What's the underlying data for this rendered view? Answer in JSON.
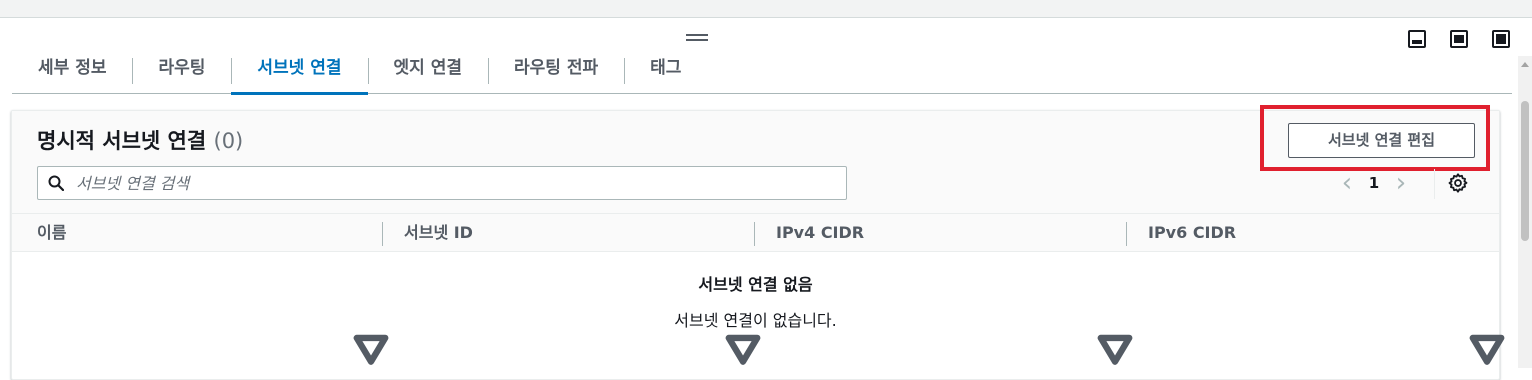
{
  "tabs": [
    {
      "label": "세부 정보"
    },
    {
      "label": "라우팅"
    },
    {
      "label": "서브넷 연결"
    },
    {
      "label": "엣지 연결"
    },
    {
      "label": "라우팅 전파"
    },
    {
      "label": "태그"
    }
  ],
  "active_tab": "서브넷 연결",
  "panel": {
    "title": "명시적 서브넷 연결",
    "count": "(0)",
    "edit_button": "서브넷 연결 편집",
    "search_placeholder": "서브넷 연결 검색",
    "page_number": "1",
    "prev_icon": "chevron-left-icon",
    "next_icon": "chevron-right-icon",
    "settings_icon": "gear-icon"
  },
  "table": {
    "columns": [
      "이름",
      "서브넷 ID",
      "IPv4 CIDR",
      "IPv6 CIDR"
    ],
    "empty_title": "서브넷 연결 없음",
    "empty_description": "서브넷 연결이 없습니다."
  },
  "colors": {
    "accent": "#0073bb",
    "highlight": "#e0202e"
  }
}
